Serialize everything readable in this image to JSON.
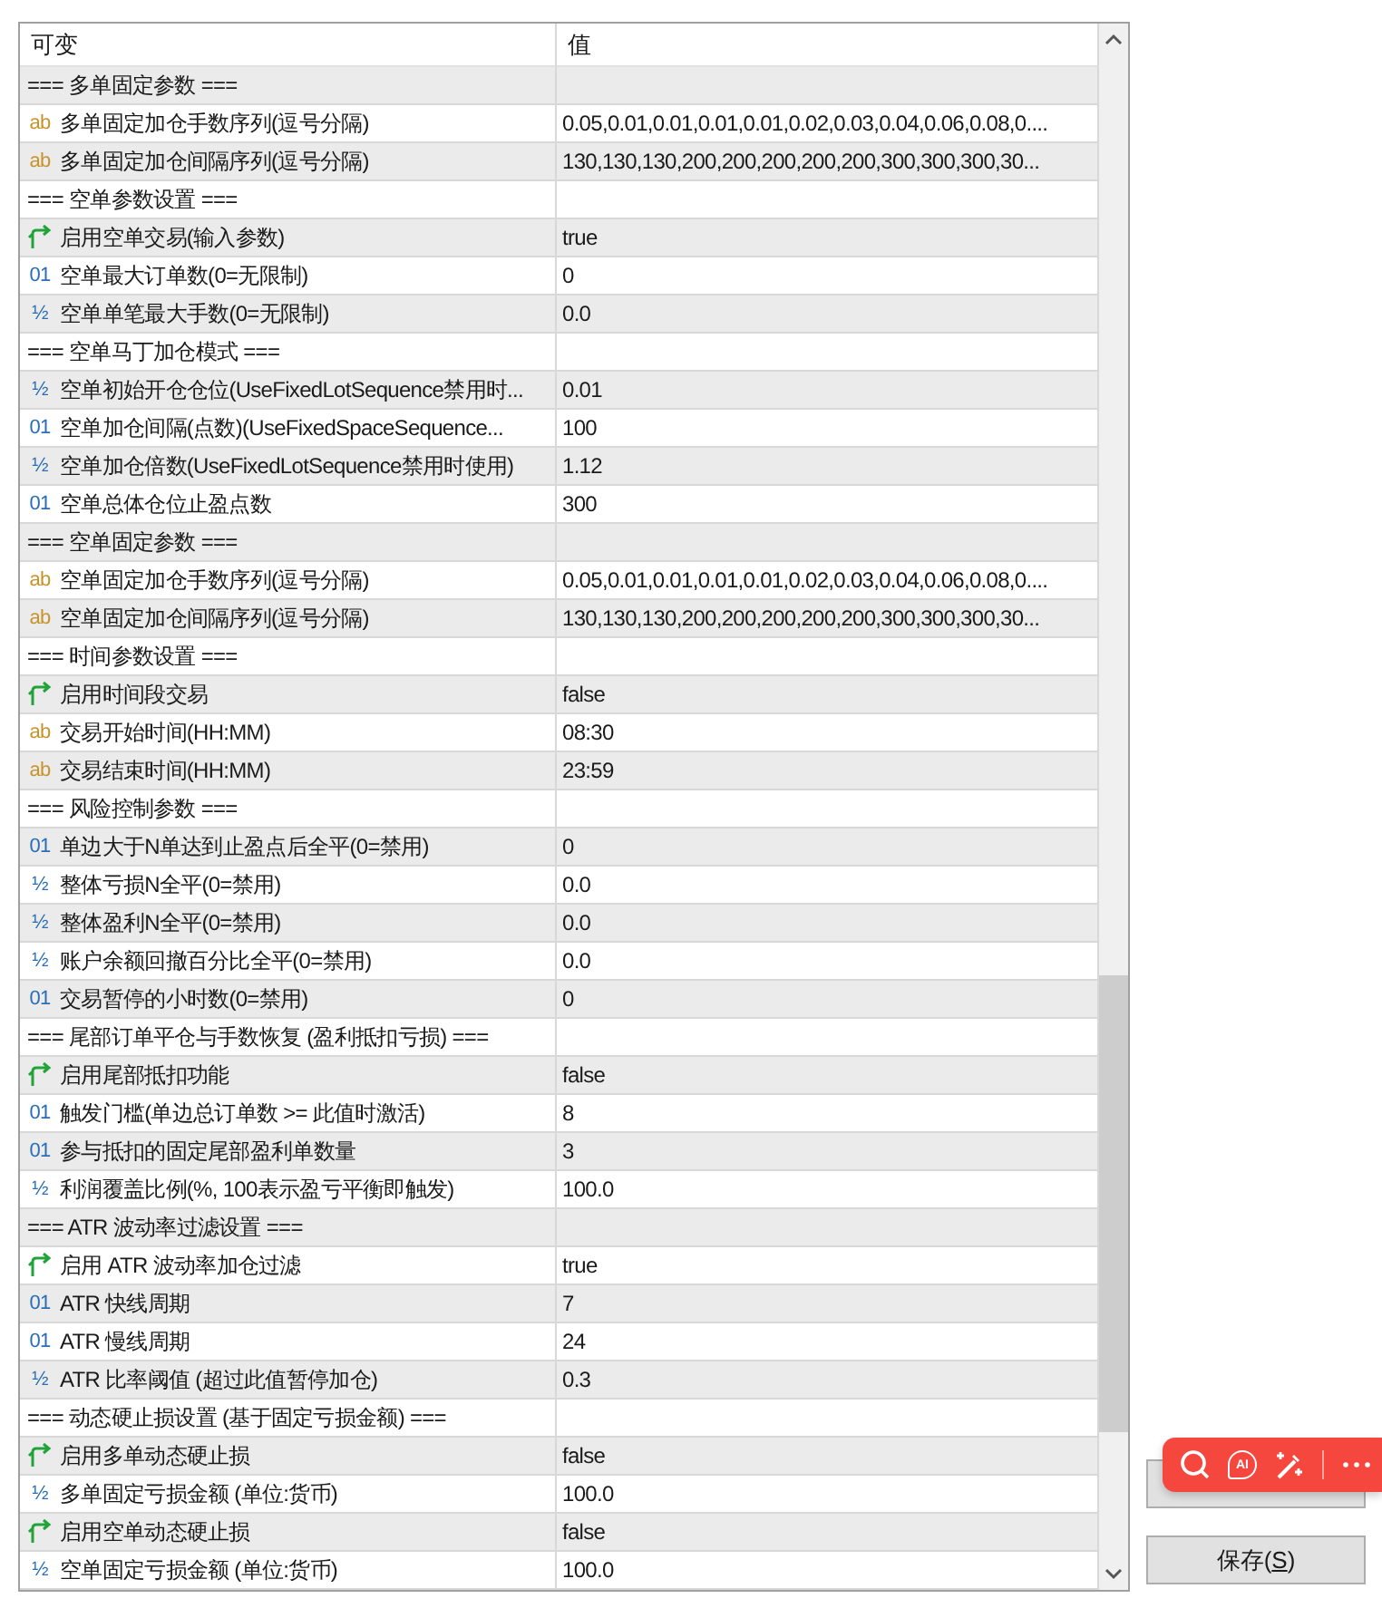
{
  "table": {
    "columns": [
      "可变",
      "值"
    ],
    "rows": [
      {
        "kind": "section",
        "name": "=== 多单固定参数 ===",
        "value": ""
      },
      {
        "kind": "string",
        "icon": "ab",
        "name": "多单固定加仓手数序列(逗号分隔)",
        "value": "0.05,0.01,0.01,0.01,0.01,0.02,0.03,0.04,0.06,0.08,0...."
      },
      {
        "kind": "string",
        "icon": "ab",
        "name": "多单固定加仓间隔序列(逗号分隔)",
        "value": "130,130,130,200,200,200,200,200,300,300,300,30..."
      },
      {
        "kind": "section",
        "name": "=== 空单参数设置 ===",
        "value": ""
      },
      {
        "kind": "bool",
        "name": "启用空单交易(输入参数)",
        "value": "true"
      },
      {
        "kind": "int",
        "icon": "01",
        "name": "空单最大订单数(0=无限制)",
        "value": "0"
      },
      {
        "kind": "double",
        "icon": "½",
        "name": "空单单笔最大手数(0=无限制)",
        "value": "0.0"
      },
      {
        "kind": "section",
        "name": "=== 空单马丁加仓模式 ===",
        "value": ""
      },
      {
        "kind": "double",
        "icon": "½",
        "name": "空单初始开仓仓位(UseFixedLotSequence禁用时...",
        "value": "0.01"
      },
      {
        "kind": "int",
        "icon": "01",
        "name": "空单加仓间隔(点数)(UseFixedSpaceSequence...",
        "value": "100"
      },
      {
        "kind": "double",
        "icon": "½",
        "name": "空单加仓倍数(UseFixedLotSequence禁用时使用)",
        "value": "1.12"
      },
      {
        "kind": "int",
        "icon": "01",
        "name": "空单总体仓位止盈点数",
        "value": "300"
      },
      {
        "kind": "section",
        "name": "=== 空单固定参数 ===",
        "value": ""
      },
      {
        "kind": "string",
        "icon": "ab",
        "name": "空单固定加仓手数序列(逗号分隔)",
        "value": "0.05,0.01,0.01,0.01,0.01,0.02,0.03,0.04,0.06,0.08,0...."
      },
      {
        "kind": "string",
        "icon": "ab",
        "name": "空单固定加仓间隔序列(逗号分隔)",
        "value": "130,130,130,200,200,200,200,200,300,300,300,30..."
      },
      {
        "kind": "section",
        "name": "=== 时间参数设置 ===",
        "value": ""
      },
      {
        "kind": "bool",
        "name": "启用时间段交易",
        "value": "false"
      },
      {
        "kind": "string",
        "icon": "ab",
        "name": "交易开始时间(HH:MM)",
        "value": "08:30"
      },
      {
        "kind": "string",
        "icon": "ab",
        "name": "交易结束时间(HH:MM)",
        "value": "23:59"
      },
      {
        "kind": "section",
        "name": "=== 风险控制参数 ===",
        "value": ""
      },
      {
        "kind": "int",
        "icon": "01",
        "name": "单边大于N单达到止盈点后全平(0=禁用)",
        "value": "0"
      },
      {
        "kind": "double",
        "icon": "½",
        "name": "整体亏损N全平(0=禁用)",
        "value": "0.0"
      },
      {
        "kind": "double",
        "icon": "½",
        "name": "整体盈利N全平(0=禁用)",
        "value": "0.0"
      },
      {
        "kind": "double",
        "icon": "½",
        "name": "账户余额回撤百分比全平(0=禁用)",
        "value": "0.0"
      },
      {
        "kind": "int",
        "icon": "01",
        "name": "交易暂停的小时数(0=禁用)",
        "value": "0"
      },
      {
        "kind": "section",
        "name": "=== 尾部订单平仓与手数恢复 (盈利抵扣亏损) ===",
        "value": ""
      },
      {
        "kind": "bool",
        "name": "启用尾部抵扣功能",
        "value": "false"
      },
      {
        "kind": "int",
        "icon": "01",
        "name": "触发门槛(单边总订单数 >= 此值时激活)",
        "value": "8"
      },
      {
        "kind": "int",
        "icon": "01",
        "name": "参与抵扣的固定尾部盈利单数量",
        "value": "3"
      },
      {
        "kind": "double",
        "icon": "½",
        "name": "利润覆盖比例(%, 100表示盈亏平衡即触发)",
        "value": "100.0"
      },
      {
        "kind": "section",
        "name": "=== ATR 波动率过滤设置 ===",
        "value": ""
      },
      {
        "kind": "bool",
        "name": "启用 ATR 波动率加仓过滤",
        "value": "true"
      },
      {
        "kind": "int",
        "icon": "01",
        "name": "ATR 快线周期",
        "value": "7"
      },
      {
        "kind": "int",
        "icon": "01",
        "name": "ATR 慢线周期",
        "value": "24"
      },
      {
        "kind": "double",
        "icon": "½",
        "name": "ATR 比率阈值 (超过此值暂停加仓)",
        "value": "0.3"
      },
      {
        "kind": "section",
        "name": "=== 动态硬止损设置 (基于固定亏损金额) ===",
        "value": ""
      },
      {
        "kind": "bool",
        "name": "启用多单动态硬止损",
        "value": "false"
      },
      {
        "kind": "double",
        "icon": "½",
        "name": "多单固定亏损金额 (单位:货币)",
        "value": "100.0"
      },
      {
        "kind": "bool",
        "name": "启用空单动态硬止损",
        "value": "false"
      },
      {
        "kind": "double",
        "icon": "½",
        "name": "空单固定亏损金额 (单位:货币)",
        "value": "100.0"
      }
    ]
  },
  "save_button": {
    "label_before": "保存(",
    "mnemonic": "S",
    "label_after": ")"
  },
  "floating_toolbar": {
    "ai_label": "AI"
  }
}
